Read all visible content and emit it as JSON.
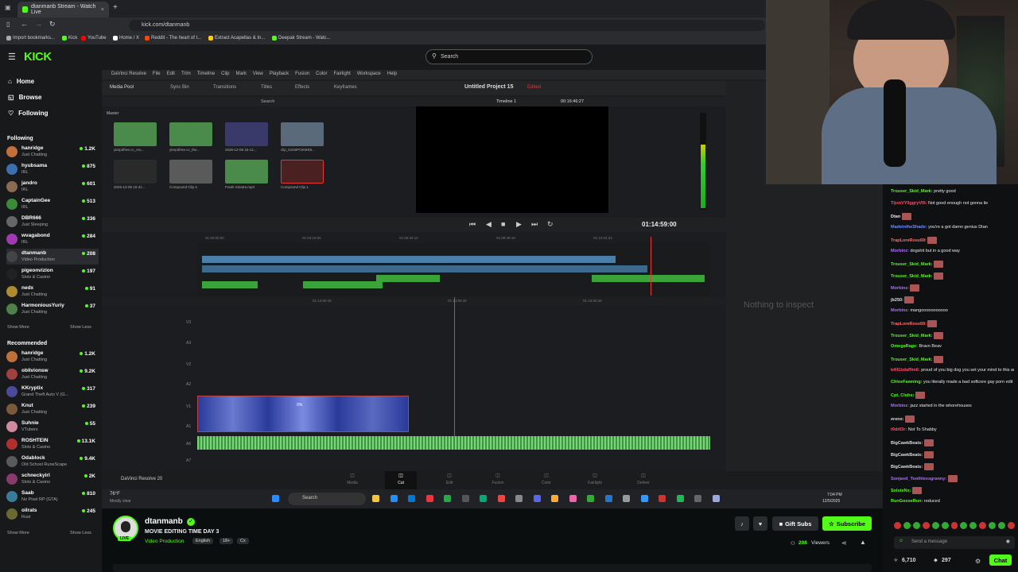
{
  "browser": {
    "tab_title": "dtanmanb Stream - Watch Live",
    "url": "kick.com/dtanmanb",
    "bookmarks": [
      "Import bookmarks...",
      "Kick",
      "YouTube",
      "Home / X",
      "Reddit - The heart of t...",
      "Extract Acapellas & In...",
      "Deepak Stream - Watc..."
    ]
  },
  "header": {
    "logo": "KICK",
    "search_placeholder": "Search"
  },
  "sidebar": {
    "nav": [
      "Home",
      "Browse",
      "Following"
    ],
    "following_title": "Following",
    "following": [
      {
        "name": "hanridge",
        "category": "Just Chatting",
        "viewers": "1.2K",
        "color": "#c0703a"
      },
      {
        "name": "hyubsama",
        "category": "IRL",
        "viewers": "875",
        "color": "#3b6fb0"
      },
      {
        "name": "jandro",
        "category": "IRL",
        "viewers": "601",
        "color": "#8a6a50"
      },
      {
        "name": "CaptainGee",
        "category": "IRL",
        "viewers": "513",
        "color": "#3a8a3a"
      },
      {
        "name": "DBR666",
        "category": "Just Sleeping",
        "viewers": "336",
        "color": "#666"
      },
      {
        "name": "wvagabond",
        "category": "IRL",
        "viewers": "284",
        "color": "#a03ab0"
      },
      {
        "name": "dtanmanb",
        "category": "Video Production",
        "viewers": "208",
        "color": "#444"
      },
      {
        "name": "pigeonvizion",
        "category": "Slots & Casino",
        "viewers": "197",
        "color": "#222"
      },
      {
        "name": "nedx",
        "category": "Just Chatting",
        "viewers": "91",
        "color": "#b08a30"
      },
      {
        "name": "HarmoniousYuriy",
        "category": "Just Chatting",
        "viewers": "37",
        "color": "#50804a"
      }
    ],
    "show_more": "Show More",
    "show_less": "Show Less",
    "recommended_title": "Recommended",
    "recommended": [
      {
        "name": "hanridge",
        "category": "Just Chatting",
        "viewers": "1.2K",
        "color": "#c0703a"
      },
      {
        "name": "oblivionsw",
        "category": "Just Chatting",
        "viewers": "9.2K",
        "color": "#a04040"
      },
      {
        "name": "KKryptix",
        "category": "Grand Theft Auto V (G...",
        "viewers": "317",
        "color": "#4a4a9a"
      },
      {
        "name": "Knut",
        "category": "Just Chatting",
        "viewers": "239",
        "color": "#7a5a3a"
      },
      {
        "name": "Suhnie",
        "category": "VTubers",
        "viewers": "55",
        "color": "#d08aa0"
      },
      {
        "name": "ROSHTEIN",
        "category": "Slots & Casino",
        "viewers": "13.1K",
        "color": "#b03030"
      },
      {
        "name": "Odablock",
        "category": "Old School RuneScape",
        "viewers": "9.4K",
        "color": "#5a5a5a"
      },
      {
        "name": "schneckyirl",
        "category": "Slots & Casino",
        "viewers": "2K",
        "color": "#8a3a6a"
      },
      {
        "name": "Saab",
        "category": "No Pixel RP (GTA)",
        "viewers": "810",
        "color": "#3a7a9a"
      },
      {
        "name": "oilrats",
        "category": "Rust",
        "viewers": "245",
        "color": "#6a6a30"
      }
    ]
  },
  "resolve": {
    "menu": [
      "DaVinci Resolve",
      "File",
      "Edit",
      "Trim",
      "Timeline",
      "Clip",
      "Mark",
      "View",
      "Playback",
      "Fusion",
      "Color",
      "Fairlight",
      "Workspace",
      "Help"
    ],
    "toolbar": [
      "Media Pool",
      "Sync Bin",
      "Transitions",
      "Titles",
      "Effects",
      "Keyframes"
    ],
    "project_title": "Untitled Project 15",
    "project_status": "Edited",
    "timeline_name": "Timeline 1",
    "timecode_top": "00:16:46:27",
    "timecode": "01:14:59:00",
    "bin_label": "Master",
    "search_label": "Search",
    "clips": [
      {
        "label": "ytmp3free.cc_mo...",
        "color": "#4a8a4a"
      },
      {
        "label": "ytmp3free.cc_the...",
        "color": "#4a8a4a"
      },
      {
        "label": "2025-12-05 16-12...",
        "color": "#3a3a6a"
      },
      {
        "label": "clip_51KBPOKMS8...",
        "color": "#5a6a7a"
      },
      {
        "label": "2025-12-05 15-31...",
        "color": "#2a2a2a"
      },
      {
        "label": "Compound Clip 4",
        "color": "#5a5a5a"
      },
      {
        "label": "Frank Sinatra.mp3",
        "color": "#4a8a4a"
      },
      {
        "label": "Compound Clip 1",
        "color": "#4a2020"
      }
    ],
    "ruler_top": [
      "01:00:00:00",
      "01:04:16:06",
      "01:06:32:12",
      "01:09:48:18",
      "01:13:04:24"
    ],
    "ruler_bottom": [
      "01:14:56:26",
      "01:14:58:26",
      "01:15:00:26"
    ],
    "tracks": [
      "V3",
      "A3",
      "V2",
      "A2",
      "V1",
      "A1",
      "A6",
      "A7"
    ],
    "inspector_text": "Nothing to inspect",
    "brand": "DaVinci Resolve 20",
    "pages": [
      "Media",
      "Cut",
      "Edit",
      "Fusion",
      "Color",
      "Fairlight",
      "Deliver"
    ],
    "active_page": "Cut",
    "clip_speed": "0%"
  },
  "taskbar": {
    "weather_temp": "76°F",
    "weather_desc": "Mostly clear",
    "search": "Search",
    "time": "7:04 PM",
    "date": "12/5/2025"
  },
  "stream": {
    "streamer": "dtanmanb",
    "title": "MOVIE EDITING TIME DAY 3",
    "category": "Video Production",
    "tags": [
      "English",
      "18+",
      "Cx"
    ],
    "live": "LIVE",
    "viewers": "208",
    "viewers_label": "Viewers",
    "gift": "Gift Subs",
    "subscribe": "Subscribe"
  },
  "chat": {
    "messages": [
      {
        "user": "Trouser_Skid_Mark:",
        "text": "pretty good",
        "color": "#53fc18"
      },
      {
        "user": "TijonVY0ggryVIII:",
        "text": "Not good enough not gonna lie",
        "color": "#ff4d6d"
      },
      {
        "user": "Dtan",
        "text": "",
        "color": "#e9e9e9"
      },
      {
        "user": "MadeintheShade:",
        "text": "you're a got damn genius Dtan",
        "color": "#6d8cff"
      },
      {
        "user": "TrapLoreRoss69:",
        "text": "",
        "color": "#ff6d6d"
      },
      {
        "user": "Morbinz:",
        "text": "dogshit but in a good way",
        "color": "#b06dff"
      },
      {
        "user": "Trouser_Skid_Mark:",
        "text": "",
        "color": "#53fc18"
      },
      {
        "user": "Trouser_Skid_Mark:",
        "text": "",
        "color": "#53fc18"
      },
      {
        "user": "Morbinz:",
        "text": "",
        "color": "#b06dff"
      },
      {
        "user": "jb250:",
        "text": "",
        "color": "#dddddd"
      },
      {
        "user": "Morbinz:",
        "text": "mangooooooooooo",
        "color": "#b06dff"
      },
      {
        "user": "TrapLoreRoss69:",
        "text": "",
        "color": "#ff6d6d"
      },
      {
        "user": "Trouser_Skid_Mark:",
        "text": "",
        "color": "#53fc18"
      },
      {
        "user": "OmegaRage:",
        "text": "Bravo Beav",
        "color": "#53fc18"
      },
      {
        "user": "Trouser_Skid_Mark:",
        "text": "",
        "color": "#53fc18"
      },
      {
        "user": "k4ll1bdaf0m6:",
        "text": "proud of you big dog you set your mind to this and killed it",
        "color": "#ff4d6d"
      },
      {
        "user": "ChloeFawning:",
        "text": "you literally made a bad softcore gay porn edit",
        "color": "#53fc18"
      },
      {
        "user": "Cpt_Clubs:",
        "text": "",
        "color": "#53fc18"
      },
      {
        "user": "Morbinz:",
        "text": "jazz started in the whorehouses",
        "color": "#b06dff"
      },
      {
        "user": "erenx:",
        "text": "",
        "color": "#dddddd"
      },
      {
        "user": "t0ddl3r:",
        "text": "Not To Shabby",
        "color": "#ff4d6d"
      },
      {
        "user": "BigCawkBeats:",
        "text": "",
        "color": "#dddddd"
      },
      {
        "user": "BigCawkBeats:",
        "text": "",
        "color": "#dddddd"
      },
      {
        "user": "BigCawkBeats:",
        "text": "",
        "color": "#dddddd"
      },
      {
        "user": "Sonjavd_Toothlessgranny:",
        "text": "",
        "color": "#b06dff"
      },
      {
        "user": "SolsteNx:",
        "text": "",
        "color": "#53fc18"
      },
      {
        "user": "RunGooseRun:",
        "text": "reduced",
        "color": "#53fc18"
      }
    ],
    "input_placeholder": "Send a message",
    "points": "6,710",
    "points2": "297",
    "send": "Chat"
  },
  "colors": {
    "kick_green": "#53fc18",
    "resolve_red": "#e33"
  }
}
